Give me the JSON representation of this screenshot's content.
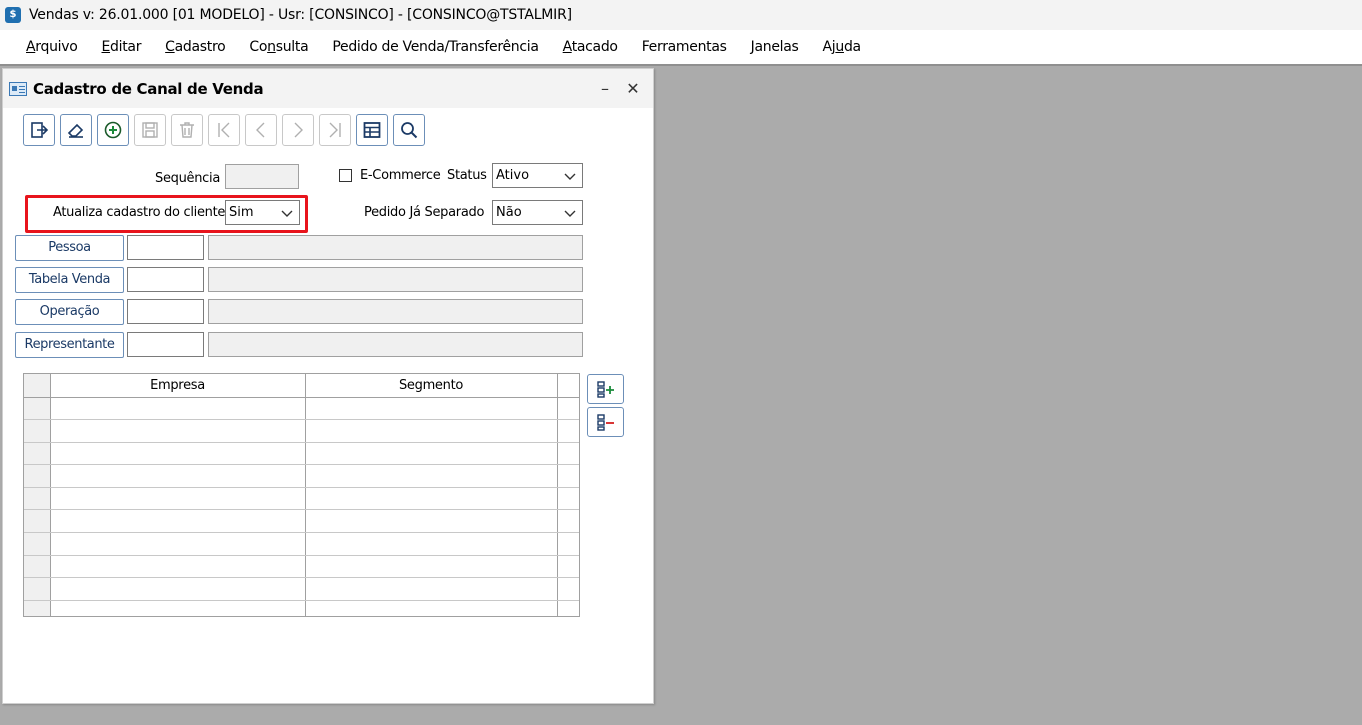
{
  "app": {
    "icon_letter": "$",
    "title": "Vendas  v: 26.01.000   [01 MODELO] - Usr: [CONSINCO] - [CONSINCO@TSTALMIR]"
  },
  "menu": [
    {
      "u": "A",
      "rest": "rquivo"
    },
    {
      "u": "E",
      "rest": "ditar"
    },
    {
      "u": "C",
      "rest": "adastro"
    },
    {
      "pre": "Co",
      "u": "n",
      "rest": "sulta"
    },
    {
      "pre": "",
      "u": "",
      "rest": "Pedido de Venda/Transferência"
    },
    {
      "u": "A",
      "rest": "tacado"
    },
    {
      "pre": "",
      "u": "",
      "rest": "Ferramentas"
    },
    {
      "u": "J",
      "rest": "anelas"
    },
    {
      "pre": "Aj",
      "u": "u",
      "rest": "da"
    }
  ],
  "window": {
    "title": "Cadastro de Canal de Venda",
    "minimize": "–",
    "close": "✕"
  },
  "toolbar": [
    {
      "icon": "exit-icon",
      "enabled": true
    },
    {
      "icon": "eraser-icon",
      "enabled": true
    },
    {
      "icon": "add-icon",
      "enabled": true
    },
    {
      "icon": "save-icon",
      "enabled": false
    },
    {
      "icon": "trash-icon",
      "enabled": false
    },
    {
      "icon": "first-record-icon",
      "enabled": false
    },
    {
      "icon": "previous-record-icon",
      "enabled": false
    },
    {
      "icon": "next-record-icon",
      "enabled": false
    },
    {
      "icon": "last-record-icon",
      "enabled": false
    },
    {
      "icon": "table-icon",
      "enabled": true
    },
    {
      "icon": "search-icon",
      "enabled": true
    }
  ],
  "form": {
    "sequencia_label": "Sequência",
    "sequencia_value": "",
    "ecommerce_label": "E-Commerce",
    "ecommerce_checked": false,
    "status_label": "Status",
    "status_value": "Ativo",
    "atualiza_label": "Atualiza cadastro do cliente",
    "atualiza_value": "Sim",
    "pedido_label": "Pedido Já Separado",
    "pedido_value": "Não",
    "pessoa_button": "Pessoa",
    "tabela_button": "Tabela Venda",
    "operacao_button": "Operação",
    "representante_button": "Representante"
  },
  "grid": {
    "columns": [
      "Empresa",
      "Segmento"
    ],
    "rows": 10
  },
  "colors": {
    "highlight": "#e8141c",
    "button_border": "#6c8fb8",
    "add_green": "#1a8a3a",
    "remove_red": "#d42020"
  }
}
